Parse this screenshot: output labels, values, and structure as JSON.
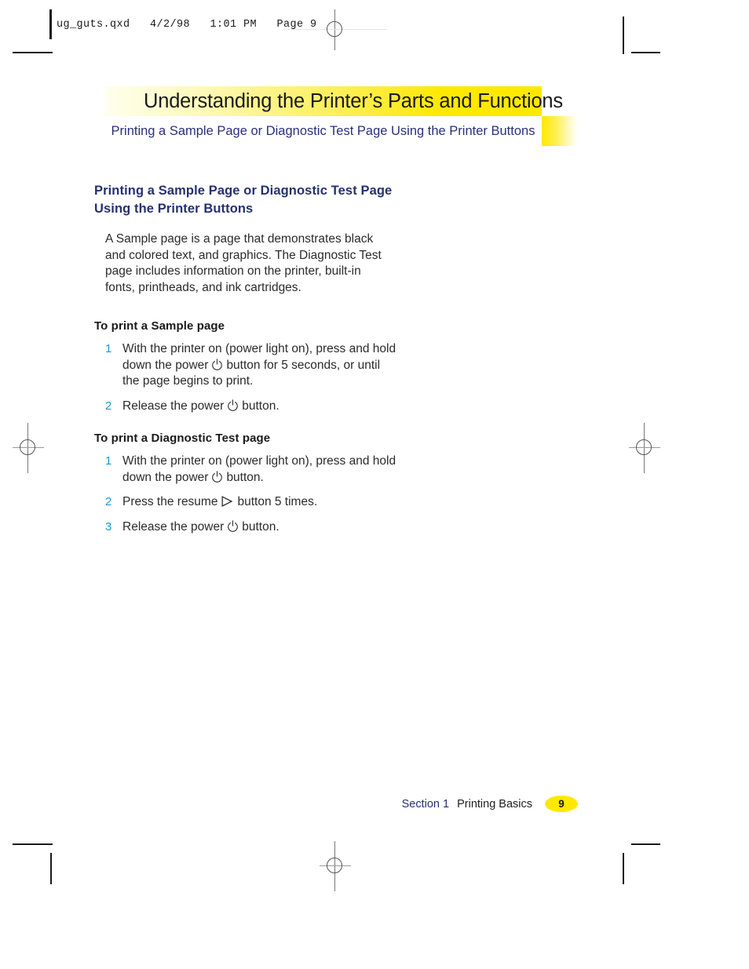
{
  "file_header": {
    "text": "ug_guts.qxd   4/2/98   1:01 PM   Page 9"
  },
  "banner": {
    "title": "Understanding the Printer’s Parts and Functions",
    "subtitle": "Printing a Sample Page or Diagnostic Test Page Using the Printer Buttons",
    "title_color": "#1a1a1a",
    "subtitle_color": "#2a2f7a",
    "accent_color": "#ffe800"
  },
  "content": {
    "section_heading_line1": "Printing a Sample Page or Diagnostic Test Page",
    "section_heading_line2": "Using the Printer Buttons",
    "section_heading_color": "#26316e",
    "intro_paragraph": "A Sample page is a page that demonstrates black and colored text, and graphics. The Diagnostic Test page includes information on the printer, built-in fonts, printheads, and ink cartridges.",
    "sample_heading": "To print a Sample page",
    "sample_steps": [
      {
        "num": "1",
        "pre": "With the printer on (power light on), press and hold down the power",
        "icon": "power-icon",
        "post": "button for 5 seconds, or until the page begins to print."
      },
      {
        "num": "2",
        "pre": "Release the power",
        "icon": "power-icon",
        "post": "button."
      }
    ],
    "diagnostic_heading": "To print a Diagnostic Test page",
    "diagnostic_steps": [
      {
        "num": "1",
        "pre": "With the printer on (power light on), press and hold down the power",
        "icon": "power-icon",
        "post": "button."
      },
      {
        "num": "2",
        "pre": "Press the resume",
        "icon": "resume-icon",
        "post": "button 5 times."
      },
      {
        "num": "3",
        "pre": "Release the power",
        "icon": "power-icon",
        "post": "button."
      }
    ],
    "step_number_color": "#1b9bd1"
  },
  "footer": {
    "section": "Section 1",
    "chapter": "Printing Basics",
    "page_number": "9",
    "badge_color": "#ffe800"
  }
}
